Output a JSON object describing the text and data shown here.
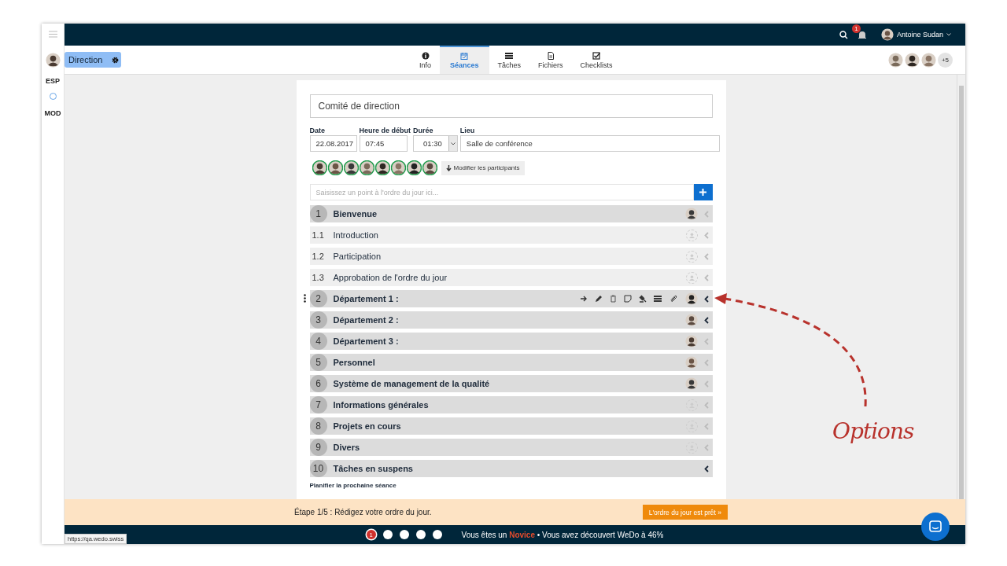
{
  "sidebar": {
    "items": [
      {
        "label": "ESP"
      },
      {
        "label": "MOD"
      }
    ]
  },
  "topbar": {
    "notifications": "1",
    "user": "Antoine Sudan"
  },
  "workspace": {
    "name": "Direction"
  },
  "tabs": [
    {
      "label": "Info",
      "selected": false
    },
    {
      "label": "Séances",
      "selected": true
    },
    {
      "label": "Tâches",
      "selected": false
    },
    {
      "label": "Fichiers",
      "selected": false
    },
    {
      "label": "Checklists",
      "selected": false
    }
  ],
  "members": {
    "more": "+5"
  },
  "meeting": {
    "title": "Comité de direction",
    "fields": [
      {
        "label": "Date",
        "value": "22.08.2017",
        "kind": "text"
      },
      {
        "label": "Heure de début",
        "value": "07:45",
        "kind": "text"
      },
      {
        "label": "Durée",
        "value": "01:30",
        "kind": "select"
      },
      {
        "label": "Lieu",
        "value": "Salle de conférence",
        "kind": "text"
      }
    ],
    "participants_button": "Modifier les participants",
    "new_item": {
      "placeholder": "Saisissez un point à l'ordre du jour ici..."
    },
    "agenda": [
      {
        "number": "1",
        "title": "Bienvenue",
        "kind": "section",
        "assigned": true,
        "active": false,
        "tools": false
      },
      {
        "number": "1.1",
        "title": "Introduction",
        "kind": "sub",
        "assigned": false,
        "active": false,
        "tools": false
      },
      {
        "number": "1.2",
        "title": "Participation",
        "kind": "sub",
        "assigned": false,
        "active": false,
        "tools": false
      },
      {
        "number": "1.3",
        "title": "Approbation de l'ordre du jour",
        "kind": "sub",
        "assigned": false,
        "active": false,
        "tools": false
      },
      {
        "number": "2",
        "title": "Département 1 :",
        "kind": "section",
        "assigned": true,
        "active": true,
        "tools": true
      },
      {
        "number": "3",
        "title": "Département 2 :",
        "kind": "section",
        "assigned": true,
        "active": true,
        "tools": false
      },
      {
        "number": "4",
        "title": "Département 3 :",
        "kind": "section",
        "assigned": true,
        "active": false,
        "tools": false
      },
      {
        "number": "5",
        "title": "Personnel",
        "kind": "section",
        "assigned": true,
        "active": false,
        "tools": false
      },
      {
        "number": "6",
        "title": "Système de management de la qualité",
        "kind": "section",
        "assigned": true,
        "active": false,
        "tools": false
      },
      {
        "number": "7",
        "title": "Informations générales",
        "kind": "section",
        "assigned": false,
        "active": false,
        "tools": false
      },
      {
        "number": "8",
        "title": "Projets en cours",
        "kind": "section",
        "assigned": false,
        "active": false,
        "tools": false
      },
      {
        "number": "9",
        "title": "Divers",
        "kind": "section",
        "assigned": false,
        "active": false,
        "tools": false
      },
      {
        "number": "10",
        "title": "Tâches en suspens",
        "kind": "section",
        "active": true,
        "tools": false
      }
    ],
    "next_meeting": "Planifier la prochaine séance"
  },
  "banner": {
    "text": "Étape 1/5 : Rédigez votre ordre du jour.",
    "button": "L'ordre du jour est prêt »"
  },
  "progress": {
    "steps": [
      {
        "label": "1",
        "selected": true
      },
      {
        "selected": false
      },
      {
        "selected": false
      },
      {
        "selected": false
      },
      {
        "selected": false
      }
    ],
    "text": "Vous êtes un **Novice** • Vous avez découvert WeDo à 46%"
  },
  "status_url": "https://qa.wedo.swiss",
  "annotation": {
    "text": "Options"
  }
}
